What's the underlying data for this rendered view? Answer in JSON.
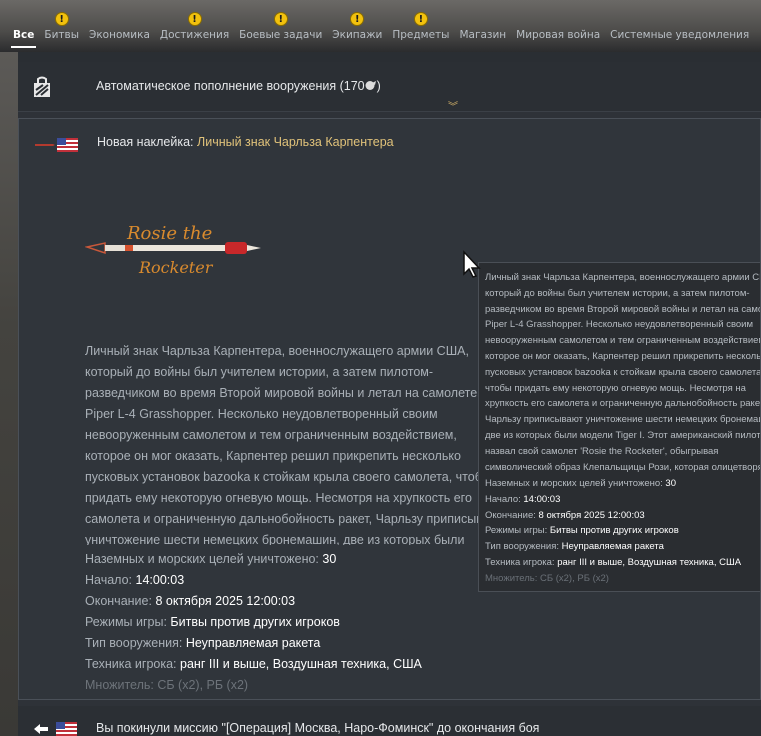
{
  "tabs": [
    {
      "label": "Все",
      "active": true,
      "warning": false
    },
    {
      "label": "Битвы",
      "active": false,
      "warning": true
    },
    {
      "label": "Экономика",
      "active": false,
      "warning": false
    },
    {
      "label": "Достижения",
      "active": false,
      "warning": true
    },
    {
      "label": "Боевые задачи",
      "active": false,
      "warning": true
    },
    {
      "label": "Экипажи",
      "active": false,
      "warning": true
    },
    {
      "label": "Предметы",
      "active": false,
      "warning": true
    },
    {
      "label": "Магазин",
      "active": false,
      "warning": false
    },
    {
      "label": "Мировая война",
      "active": false,
      "warning": false
    },
    {
      "label": "Системные уведомления",
      "active": false,
      "warning": false
    }
  ],
  "warning_glyph": "!",
  "auto_replenish": {
    "text": "Автоматическое пополнение вооружения (170",
    "currency_icon": "silver-lion-icon",
    "text_end": ")"
  },
  "decal_notification": {
    "prefix": "Новая наклейка: ",
    "name": "Личный знак Чарльза Карпентера",
    "name_color": "#e0c27a",
    "decal_text_1": "Rosie the",
    "decal_text_2": "Rocketer",
    "description": "Личный знак Чарльза Карпентера, военнослужащего армии США, который до войны был учителем истории, а затем пилотом-разведчиком во время Второй мировой войны и летал на самолете Piper L-4 Grasshopper. Несколько неудовлетворенный своим невооруженным самолетом и тем ограниченным воздействием, которое он мог оказать, Карпентер решил прикрепить несколько пусковых установок bazooka к стойкам крыла своего самолета, чтобы придать ему некоторую огневую мощь. Несмотря на хрупкость его самолета и ограниченную дальнобойность ракет, Чарльзу приписывают уничтожение шести немецких бронемашин, две из которых были модели Tiger I. Этот американский пилот назвал свой самолет \"Rosie the Rocketer\", обыгрывая символический образ Клепальщицы Рози, которая олицетворяла женщин, составлявших значительную часть заводской рабочей силы Америки во время Второй мировой войны. Несколько сконструированная ракета и сопроводительная надпись были нарисованы на правой стороне под кабиной пилота.",
    "stats": [
      {
        "label": "Наземных и морских целей уничтожено: ",
        "value": "30"
      },
      {
        "label": "Начало: ",
        "value": "14:00:03"
      },
      {
        "label": "Окончание: ",
        "value": "8 октября 2025 12:00:03"
      },
      {
        "label": "Режимы игры: ",
        "value": "Битвы против других игроков"
      },
      {
        "label": "Тип вооружения: ",
        "value": "Неуправляемая ракета"
      },
      {
        "label": "Техника игрока: ",
        "value": "ранг III и выше, Воздушная техника, США"
      }
    ],
    "multiplier": "Множитель: СБ (x2), РБ (x2)"
  },
  "tooltip": {
    "description": "Личный знак Чарльза Карпентера, военнослужащего армии США, который до войны был учителем истории, а затем пилотом-разведчиком во время Второй мировой войны и летал на самолете Piper L-4 Grasshopper. Несколько неудовлетворенный своим невооруженным самолетом и тем ограниченным воздействием, которое он мог оказать, Карпентер решил прикрепить несколько пусковых установок bazooka к стойкам крыла своего самолета, чтобы придать ему некоторую огневую мощь. Несмотря на хрупкость его самолета и ограниченную дальнобойность ракет, Чарльзу приписывают уничтожение шести немецких бронемашин, две из которых были модели Tiger I. Этот американский пилот назвал свой самолет 'Rosie the Rocketer', обыгрывая символический образ Клепальщицы Рози, которая олицетворяла женщин, составлявших значительную часть заводской рабочей силы Америки во время Второй мировой войны. Несколько сконструированная ракета и сопроводительная надпись были нарисованы на правой стороне под кабиной пилота."
  },
  "bottom_notification": {
    "text": "Вы покинули миссию \"[Операция] Москва, Наро-Фоминск\" до окончания боя"
  },
  "colors": {
    "accent_gold": "#e0c27a",
    "warning_yellow": "#f2c10e",
    "panel_bg": "#30353b"
  }
}
